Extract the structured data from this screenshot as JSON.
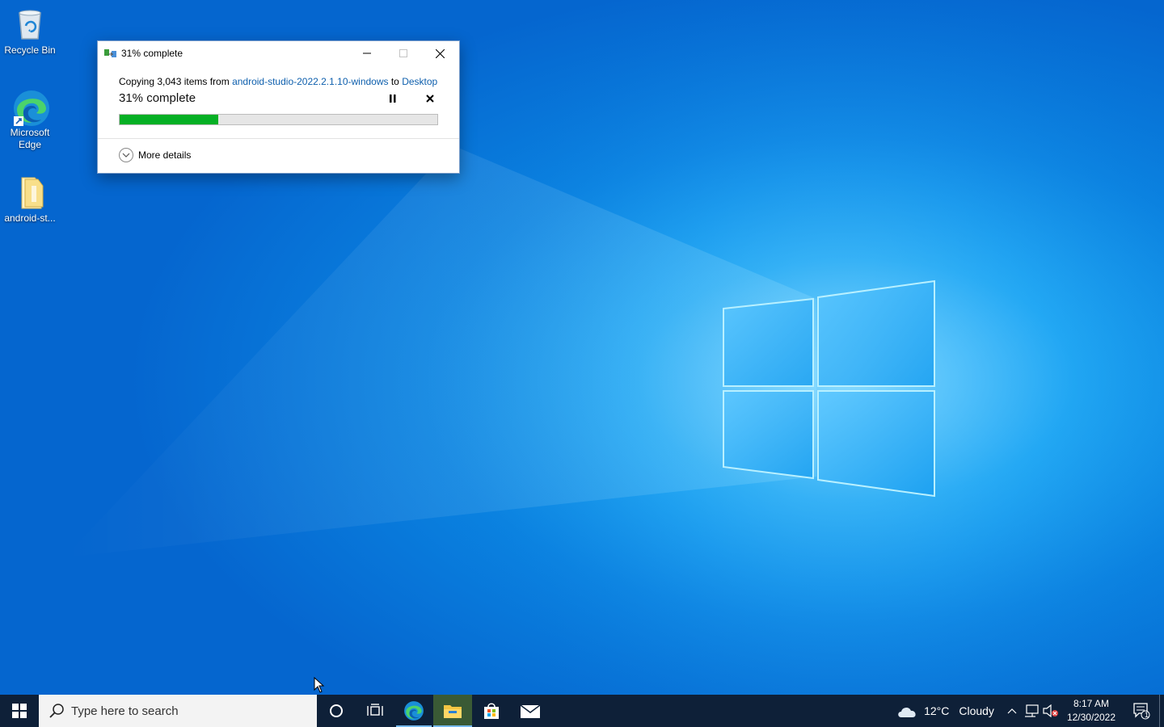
{
  "desktop": {
    "icons": [
      {
        "label": "Recycle Bin",
        "icon": "recycle-bin-icon"
      },
      {
        "label": "Microsoft Edge",
        "icon": "edge-icon"
      },
      {
        "label": "android-st...",
        "icon": "folder-icon"
      }
    ]
  },
  "dialog": {
    "title": "31% complete",
    "copy_prefix": "Copying 3,043 items from ",
    "source": "android-studio-2022.2.1.10-windows",
    "to_word": " to ",
    "destination": "Desktop",
    "status": "31% complete",
    "progress_percent": 31,
    "more_details": "More details",
    "colors": {
      "progress_fill": "#06b025",
      "link": "#0e5fad"
    }
  },
  "taskbar": {
    "search_placeholder": "Type here to search",
    "apps": [
      {
        "name": "cortana-icon"
      },
      {
        "name": "task-view-icon"
      },
      {
        "name": "edge-icon",
        "state": "active"
      },
      {
        "name": "file-explorer-icon",
        "state": "running"
      },
      {
        "name": "store-icon"
      },
      {
        "name": "mail-icon"
      }
    ],
    "weather": {
      "temp": "12°C",
      "condition": "Cloudy"
    },
    "clock": {
      "time": "8:17 AM",
      "date": "12/30/2022"
    },
    "notification_count": "1"
  }
}
